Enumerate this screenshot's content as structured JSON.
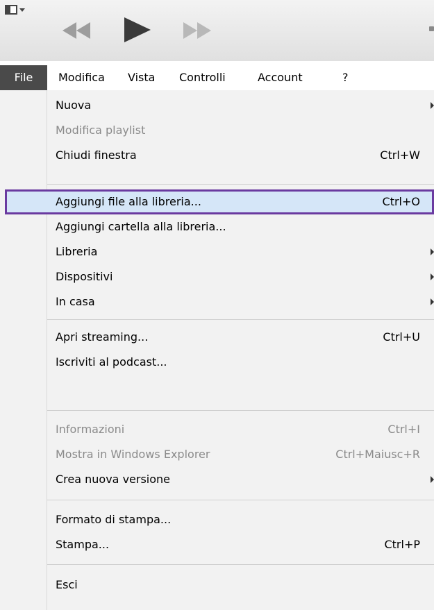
{
  "menubar": {
    "items": [
      "File",
      "Modifica",
      "Vista",
      "Controlli",
      "Account",
      "?"
    ]
  },
  "menu": {
    "items": [
      {
        "label": "Nuova",
        "shortcut": "",
        "submenu": true,
        "disabled": false
      },
      {
        "label": "Modifica playlist",
        "shortcut": "",
        "submenu": false,
        "disabled": true
      },
      {
        "label": "Chiudi finestra",
        "shortcut": "Ctrl+W",
        "submenu": false,
        "disabled": false
      },
      {
        "label": "Aggiungi file alla libreria...",
        "shortcut": "Ctrl+O",
        "submenu": false,
        "disabled": false,
        "highlighted": true
      },
      {
        "label": "Aggiungi cartella alla libreria...",
        "shortcut": "",
        "submenu": false,
        "disabled": false
      },
      {
        "label": "Libreria",
        "shortcut": "",
        "submenu": true,
        "disabled": false
      },
      {
        "label": "Dispositivi",
        "shortcut": "",
        "submenu": true,
        "disabled": false
      },
      {
        "label": "In casa",
        "shortcut": "",
        "submenu": true,
        "disabled": false
      },
      {
        "label": "Apri streaming...",
        "shortcut": "Ctrl+U",
        "submenu": false,
        "disabled": false
      },
      {
        "label": "Iscriviti al podcast...",
        "shortcut": "",
        "submenu": false,
        "disabled": false
      },
      {
        "label": "Informazioni",
        "shortcut": "Ctrl+I",
        "submenu": false,
        "disabled": true
      },
      {
        "label": "Mostra in Windows Explorer",
        "shortcut": "Ctrl+Maiusc+R",
        "submenu": false,
        "disabled": true
      },
      {
        "label": "Crea nuova versione",
        "shortcut": "",
        "submenu": true,
        "disabled": false
      },
      {
        "label": "Formato di stampa...",
        "shortcut": "",
        "submenu": false,
        "disabled": false
      },
      {
        "label": "Stampa...",
        "shortcut": "Ctrl+P",
        "submenu": false,
        "disabled": false
      },
      {
        "label": "Esci",
        "shortcut": "",
        "submenu": false,
        "disabled": false
      }
    ]
  },
  "icons": {
    "app": "window-menu-icon",
    "previous": "rewind-icon",
    "play": "play-icon",
    "next": "fast-forward-icon"
  },
  "colors": {
    "active_menu_bg": "#4a4a4a",
    "highlight_border": "#6a3aa0",
    "highlight_fill": "#d5e6f8",
    "disabled_text": "#8a8a8a"
  }
}
